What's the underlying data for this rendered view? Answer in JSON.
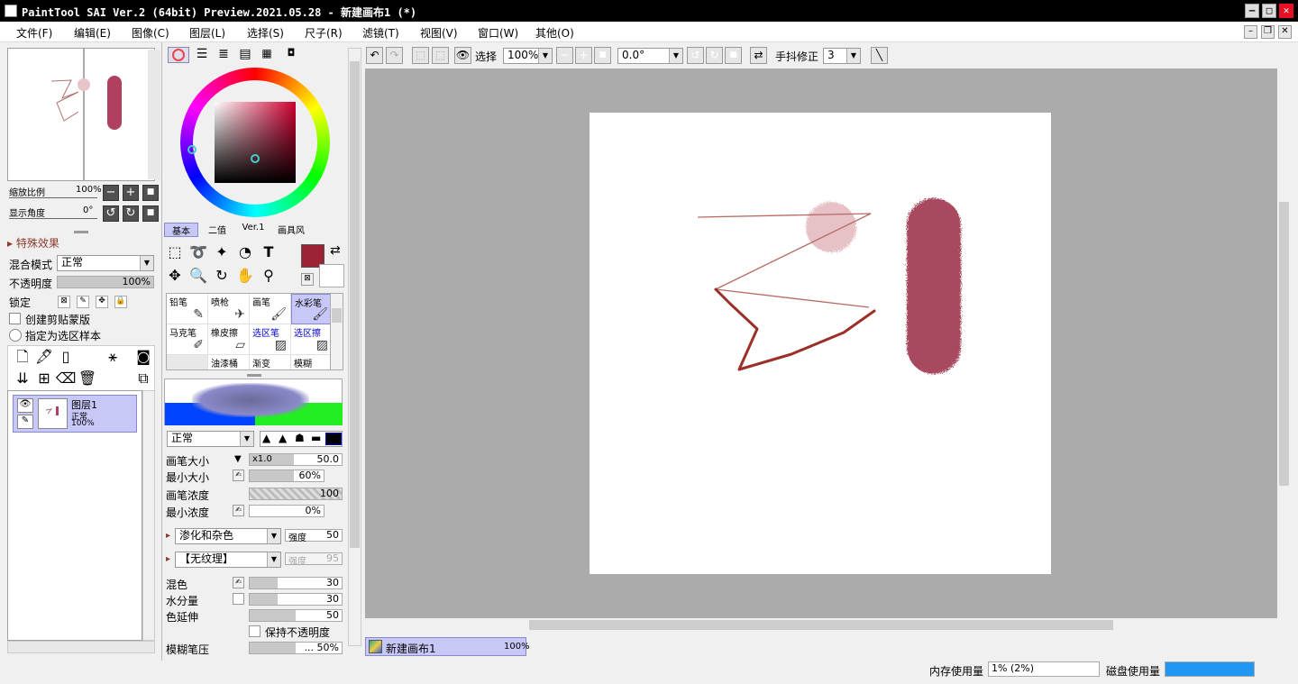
{
  "window": {
    "title": "PaintTool SAI Ver.2 (64bit) Preview.2021.05.28 - 新建画布1 (*)"
  },
  "menu": [
    "文件(F)",
    "编辑(E)",
    "图像(C)",
    "图层(L)",
    "选择(S)",
    "尺子(R)",
    "滤镜(T)",
    "视图(V)",
    "窗口(W)",
    "其他(O)"
  ],
  "navigator": {
    "zoom_label": "缩放比例",
    "zoom_value": "100%",
    "angle_label": "显示角度",
    "angle_value": "0°"
  },
  "layer_panel": {
    "effects_label": "特殊效果",
    "blend_label": "混合模式",
    "blend_value": "正常",
    "opacity_label": "不透明度",
    "opacity_value": "100%",
    "lock_label": "锁定",
    "clip_label": "创建剪贴蒙版",
    "selsrc_label": "指定为选区样本",
    "layer": {
      "name": "图层1",
      "mode": "正常",
      "opacity": "100%"
    }
  },
  "color_tabs": [
    "基本",
    "二值",
    "Ver.1",
    "画具风"
  ],
  "brushes": [
    [
      "铅笔",
      "喷枪",
      "画笔",
      "水彩笔"
    ],
    [
      "马克笔",
      "橡皮擦",
      "选区笔",
      "选区擦"
    ],
    [
      "",
      "油漆桶",
      "渐变",
      "模糊"
    ]
  ],
  "brush_settings": {
    "mode": "正常",
    "size_label": "画笔大小",
    "size_mult": "x1.0",
    "size_value": "50.0",
    "minsize_label": "最小大小",
    "minsize_value": "60%",
    "density_label": "画笔浓度",
    "density_value": "100",
    "mindens_label": "最小浓度",
    "mindens_value": "0%",
    "blur_label": "渗化和杂色",
    "strength_label": "强度",
    "strength_value": "50",
    "texture_label": "【无纹理】",
    "tex_strength_label": "强度",
    "tex_strength_value": "95",
    "mix_label": "混色",
    "mix_value": "30",
    "water_label": "水分量",
    "water_value": "30",
    "stretch_label": "色延伸",
    "stretch_value": "50",
    "keep_label": "保持不透明度",
    "blurpress_label": "模糊笔压",
    "blurpress_value": "... 50%"
  },
  "toolbar": {
    "select_label": "选择",
    "zoom": "100%",
    "angle": "0.0°",
    "stab_label": "手抖修正",
    "stab_value": "3"
  },
  "canvas_tab": {
    "name": "新建画布1",
    "zoom": "100%"
  },
  "status": {
    "mem_label": "内存使用量",
    "mem_value": "1% (2%)",
    "disk_label": "磁盘使用量"
  },
  "colors": {
    "primary": "#9b2335",
    "accent": "#c8c8f8"
  }
}
